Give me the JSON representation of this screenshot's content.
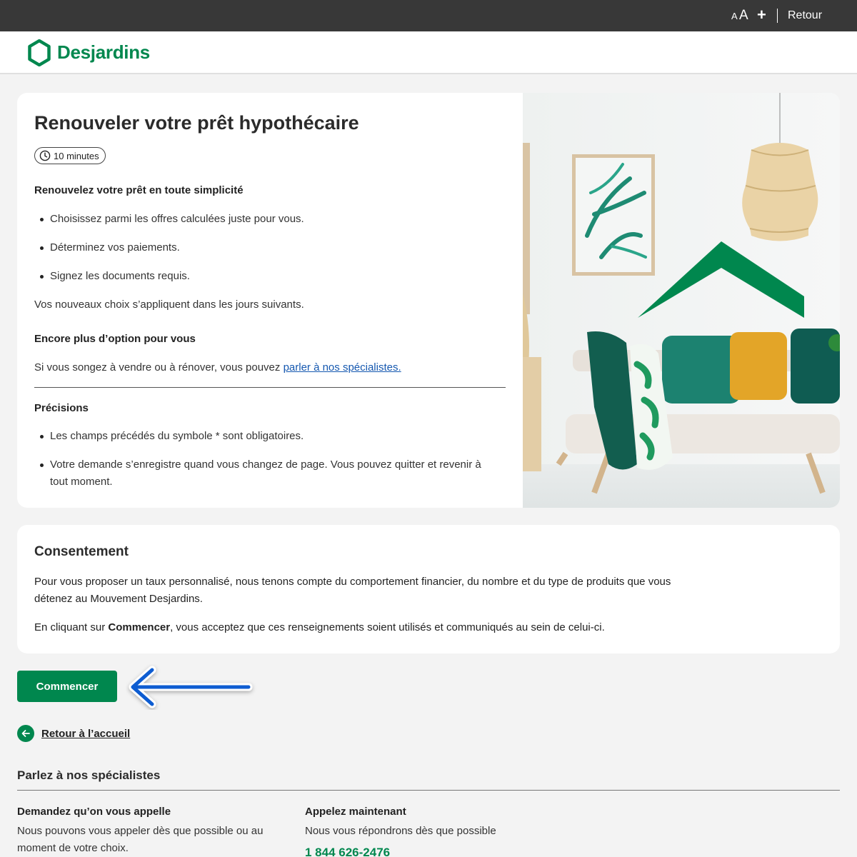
{
  "topbar": {
    "font_small": "A",
    "font_large": "A",
    "plus": "+",
    "back_label": "Retour"
  },
  "brand": {
    "name": "Desjardins",
    "color": "#00874e"
  },
  "intro": {
    "title": "Renouveler votre prêt hypothécaire",
    "duration": "10 minutes",
    "section1_heading": "Renouvelez votre prêt en toute simplicité",
    "bullets1": [
      "Choisissez parmi les offres calculées juste pour vous.",
      "Déterminez vos paiements.",
      "Signez les documents requis."
    ],
    "note": "Vos nouveaux choix s’appliquent dans les jours suivants.",
    "section2_heading": "Encore plus d’option pour vous",
    "section2_text": "Si vous songez à vendre ou à rénover, vous pouvez ",
    "section2_link": "parler à nos spécialistes.",
    "section3_heading": "Précisions",
    "bullets2": [
      "Les champs précédés du symbole * sont obligatoires.",
      "Votre demande s’enregistre quand vous changez de page. Vous pouvez quitter et revenir à tout moment."
    ]
  },
  "consent": {
    "title": "Consentement",
    "paragraph1": "Pour vous proposer un taux personnalisé, nous tenons compte du comportement financier, du nombre et du type de produits que vous détenez au Mouvement Desjardins.",
    "paragraph2_before": "En cliquant sur ",
    "paragraph2_bold": "Commencer",
    "paragraph2_after": ", vous acceptez que ces renseignements soient utilisés et communiqués au sein de celui-ci."
  },
  "actions": {
    "start_label": "Commencer",
    "back_home_label": "Retour à l’accueil"
  },
  "specialists": {
    "title": "Parlez à nos spécialistes",
    "col1_title": "Demandez qu’on vous appelle",
    "col1_text": "Nous pouvons vous appeler dès que possible ou au moment de votre choix.",
    "col2_title": "Appelez maintenant",
    "col2_text": "Nous vous répondrons dès que possible",
    "phone": "1 844 626-2476"
  },
  "colors": {
    "topbar": "#383838",
    "brand_green": "#00874e",
    "link_blue": "#1558b0",
    "callout_arrow": "#0a5bd1"
  }
}
